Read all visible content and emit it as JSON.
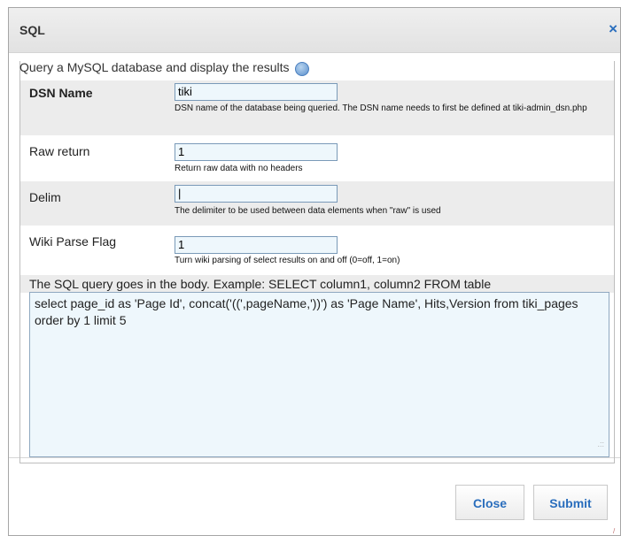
{
  "dialog": {
    "title": "SQL",
    "close_icon": "×"
  },
  "intro": "Query a MySQL database and display the results",
  "params": [
    {
      "label": "DSN Name",
      "value": "tiki",
      "description": "DSN name of the database being queried. The DSN name needs to first be defined at tiki-admin_dsn.php"
    },
    {
      "label": "Raw return",
      "value": "1",
      "description": "Return raw data with no headers"
    },
    {
      "label": "Delim",
      "value": "|",
      "description": "The delimiter to be used between data elements when \"raw\" is used"
    },
    {
      "label": "Wiki Parse Flag",
      "value": "1",
      "description": "Turn wiki parsing of select results on and off (0=off, 1=on)"
    }
  ],
  "body": {
    "label": "The SQL query goes in the body. Example: SELECT column1, column2 FROM table",
    "value": "select page_id as 'Page Id', concat('((',pageName,'))') as 'Page Name', Hits,Version from tiki_pages order by 1 limit 5"
  },
  "buttons": {
    "close": "Close",
    "submit": "Submit"
  },
  "icons": {
    "help": "help-icon",
    "close": "close-icon",
    "resize": "resize-grip-icon"
  },
  "colors": {
    "accent": "#2a6ebd",
    "field_bg": "#eef7fc",
    "row_shade": "#ececec"
  }
}
